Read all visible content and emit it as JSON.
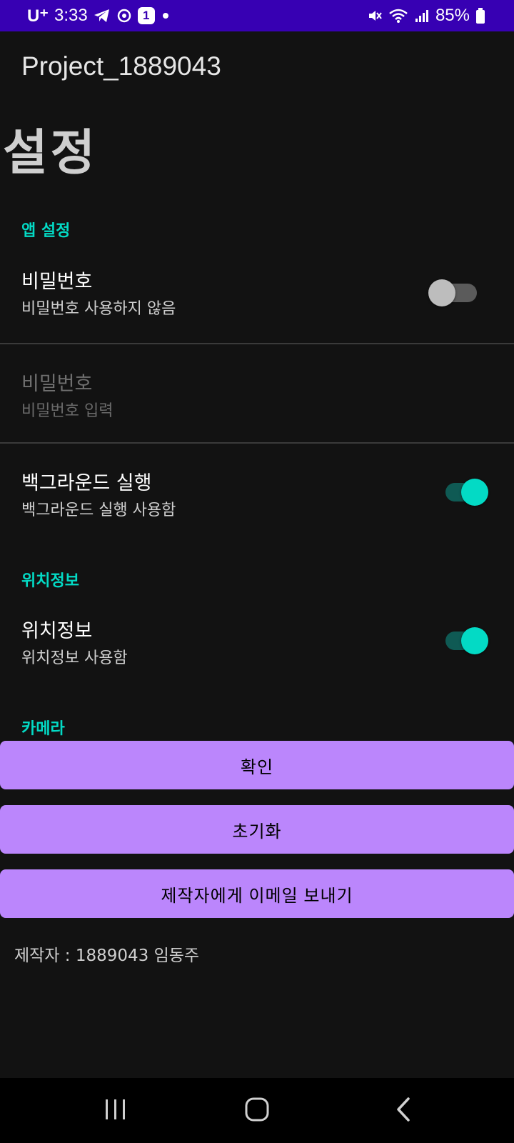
{
  "status_bar": {
    "carrier": "U⁺",
    "time": "3:33",
    "notification_badge": "1",
    "battery": "85%",
    "icons": [
      "telegram-icon",
      "sync-icon",
      "notification-badge-icon",
      "dot-icon",
      "mute-icon",
      "wifi-icon",
      "signal-icon",
      "battery-icon"
    ]
  },
  "app_bar": {
    "title": "Project_1889043"
  },
  "page": {
    "title": "설정"
  },
  "sections": {
    "app_settings": {
      "header": "앱 설정",
      "password_toggle": {
        "title": "비밀번호",
        "summary": "비밀번호 사용하지 않음",
        "checked": false
      },
      "password_input": {
        "title": "비밀번호",
        "summary": "비밀번호 입력",
        "enabled": false
      },
      "background_run": {
        "title": "백그라운드 실행",
        "summary": "백그라운드 실행 사용함",
        "checked": true
      }
    },
    "location": {
      "header": "위치정보",
      "location_toggle": {
        "title": "위치정보",
        "summary": "위치정보 사용함",
        "checked": true
      }
    },
    "camera": {
      "header": "카메라"
    }
  },
  "buttons": {
    "confirm": "확인",
    "reset": "초기화",
    "email": "제작자에게 이메일 보내기"
  },
  "footer": {
    "author": "제작자 : 1889043 임동주"
  },
  "nav_bar": {
    "icons": [
      "recents-icon",
      "home-icon",
      "back-icon"
    ]
  },
  "colors": {
    "status_bar": "#3700b3",
    "background": "#121212",
    "accent": "#03dac5",
    "button": "#bb86fc",
    "nav_bar": "#000000"
  }
}
